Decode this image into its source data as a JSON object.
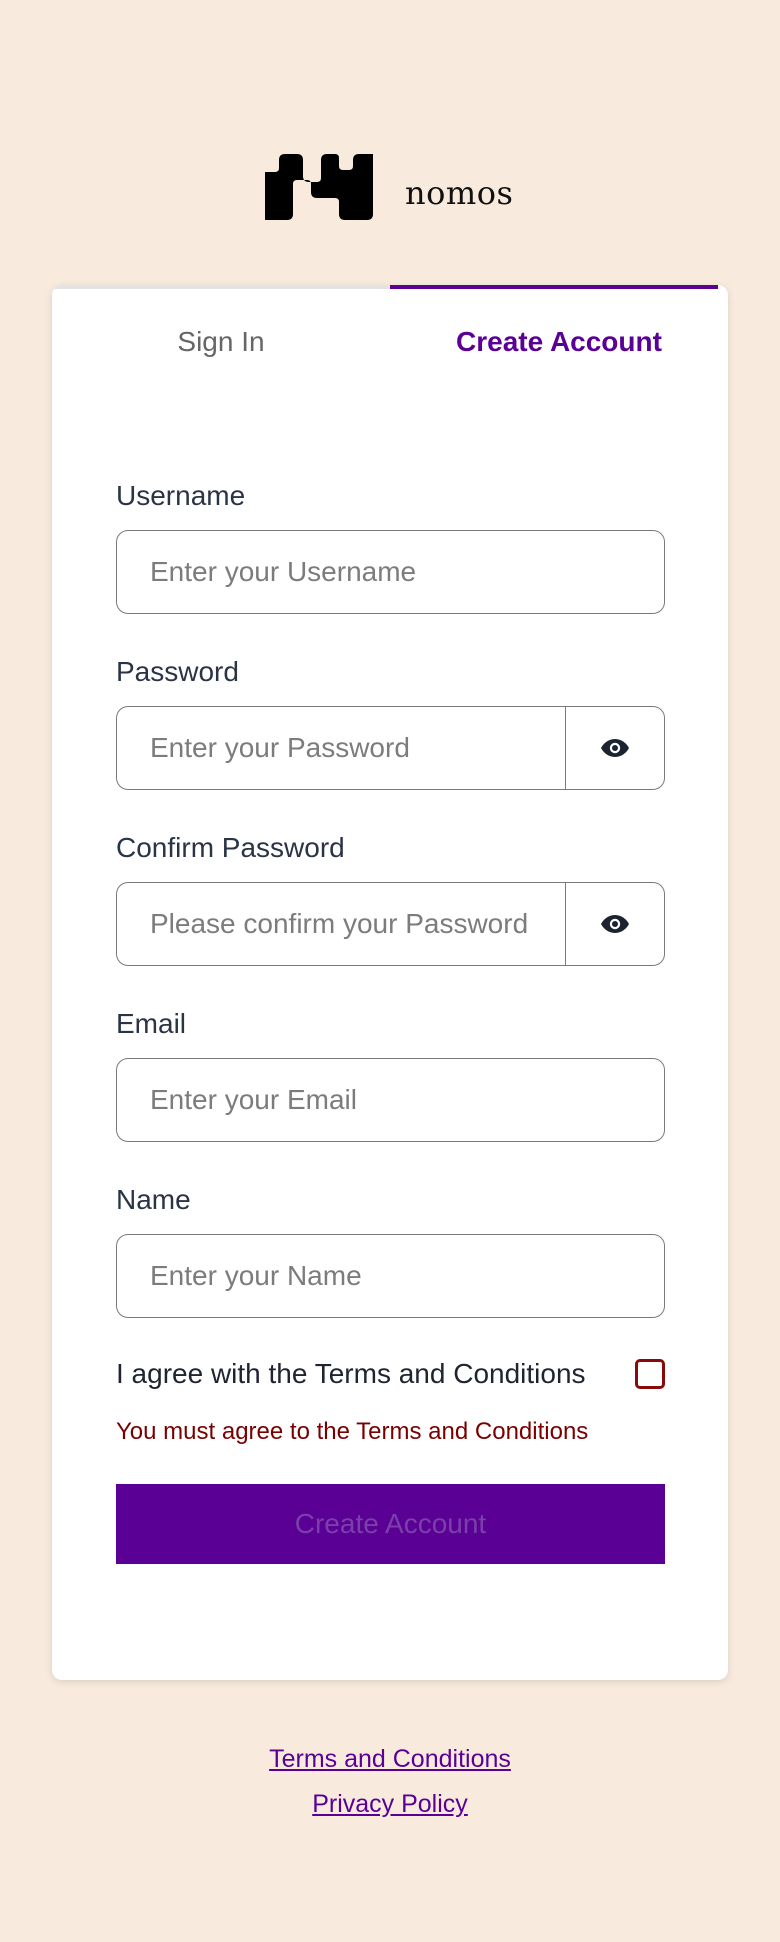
{
  "brand": {
    "name": "nomos",
    "logo_icon": "nomos-logo-icon"
  },
  "tabs": [
    {
      "label": "Sign In",
      "active": false
    },
    {
      "label": "Create Account",
      "active": true
    }
  ],
  "form": {
    "username": {
      "label": "Username",
      "placeholder": "Enter your Username",
      "value": ""
    },
    "password": {
      "label": "Password",
      "placeholder": "Enter your Password",
      "value": "",
      "toggle_icon": "eye-icon"
    },
    "confirm_password": {
      "label": "Confirm Password",
      "placeholder": "Please confirm your Password",
      "value": "",
      "toggle_icon": "eye-icon"
    },
    "email": {
      "label": "Email",
      "placeholder": "Enter your Email",
      "value": ""
    },
    "name": {
      "label": "Name",
      "placeholder": "Enter your Name",
      "value": ""
    },
    "terms": {
      "label": "I agree with the Terms and Conditions",
      "checked": false
    },
    "error": "You must agree to the Terms and Conditions",
    "submit_label": "Create Account"
  },
  "footer": {
    "links": [
      "Terms and Conditions",
      "Privacy Policy"
    ]
  },
  "colors": {
    "background": "#f8ebde",
    "accent": "#5a0095",
    "error": "#7a0000"
  }
}
